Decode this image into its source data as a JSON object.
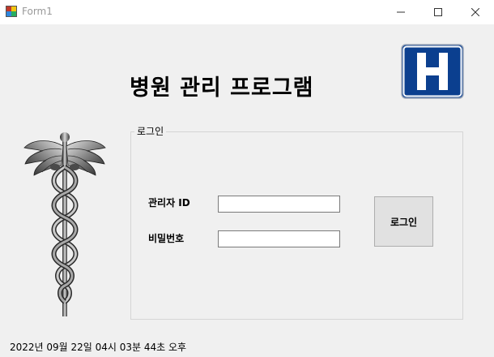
{
  "window": {
    "title": "Form1",
    "icon": "winforms-app-icon"
  },
  "header": {
    "title": "병원 관리 프로그램",
    "logo_letter": "H",
    "logo_color": "#0b3f8f"
  },
  "login": {
    "group_label": "로그인",
    "id_label": "관리자 ID",
    "id_value": "",
    "password_label": "비밀번호",
    "password_value": "",
    "button_label": "로그인"
  },
  "status": {
    "datetime": "2022년 09월 22일 04시 03분 44초 오후"
  }
}
